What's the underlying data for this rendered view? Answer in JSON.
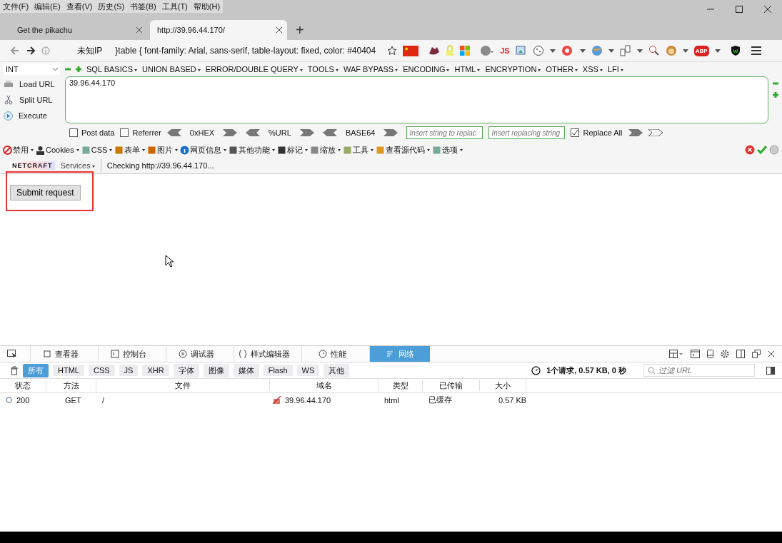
{
  "menu_bar": [
    "文件(F)",
    "编辑(E)",
    "查看(V)",
    "历史(S)",
    "书签(B)",
    "工具(T)",
    "帮助(H)"
  ],
  "tabs": [
    {
      "title": "Get the pikachu",
      "selected": false
    },
    {
      "title": "http://39.96.44.170/",
      "selected": true
    }
  ],
  "new_tab": "+",
  "address_bar": {
    "identity": "未知IP",
    "text": "}table { font-family: Arial, sans-serif, table-layout: fixed, color: #40404"
  },
  "extension_labels": {
    "js": "JS",
    "abp": "ABP"
  },
  "hackbar": {
    "select": "INT",
    "menus": [
      "SQL BASICS",
      "UNION BASED",
      "ERROR/DOUBLE QUERY",
      "TOOLS",
      "WAF BYPASS",
      "ENCODING",
      "HTML",
      "ENCRYPTION",
      "OTHER",
      "XSS",
      "LFI"
    ],
    "actions": [
      "Load URL",
      "Split URL",
      "Execute"
    ],
    "url": "39.96.44.170",
    "post_data": {
      "label": "Post data",
      "checked": false
    },
    "referrer": {
      "label": "Referrer",
      "checked": false
    },
    "encoders": [
      "0xHEX",
      "%URL",
      "BASE64"
    ],
    "replace_from": {
      "placeholder": "Insert string to replac"
    },
    "replace_to": {
      "placeholder": "Insert replacing string"
    },
    "replace_all": {
      "label": "Replace All",
      "checked": true
    }
  },
  "webdev_toolbar": [
    "禁用",
    "Cookies",
    "CSS",
    "表单",
    "图片",
    "网页信息",
    "其他功能",
    "标记",
    "缩放",
    "工具",
    "查看源代码",
    "选项"
  ],
  "netcraft": {
    "logo": "NETCRAFT",
    "services": "Services",
    "status": "Checking http://39.96.44.170..."
  },
  "page": {
    "button": "Submit request",
    "highlighted": true
  },
  "devtools": {
    "tabs": [
      {
        "label": "查看器",
        "selected": false
      },
      {
        "label": "控制台",
        "selected": false
      },
      {
        "label": "调试器",
        "selected": false
      },
      {
        "label": "样式编辑器",
        "selected": false
      },
      {
        "label": "性能",
        "selected": false
      },
      {
        "label": "网络",
        "selected": true
      }
    ],
    "filters": [
      {
        "label": "所有",
        "selected": true
      },
      {
        "label": "HTML",
        "selected": false
      },
      {
        "label": "CSS",
        "selected": false
      },
      {
        "label": "JS",
        "selected": false
      },
      {
        "label": "XHR",
        "selected": false
      },
      {
        "label": "字体",
        "selected": false
      },
      {
        "label": "图像",
        "selected": false
      },
      {
        "label": "媒体",
        "selected": false
      },
      {
        "label": "Flash",
        "selected": false
      },
      {
        "label": "WS",
        "selected": false
      },
      {
        "label": "其他",
        "selected": false
      }
    ],
    "summary": "1个请求, 0.57 KB, 0 秒",
    "filter": {
      "placeholder": "过滤 URL"
    },
    "columns": [
      "状态",
      "方法",
      "文件",
      "域名",
      "类型",
      "已传输",
      "大小"
    ],
    "rows": [
      {
        "cells": [
          "200",
          "GET",
          "/",
          "39.96.44.170",
          "html",
          "已缓存",
          "0.57 KB"
        ]
      }
    ]
  }
}
